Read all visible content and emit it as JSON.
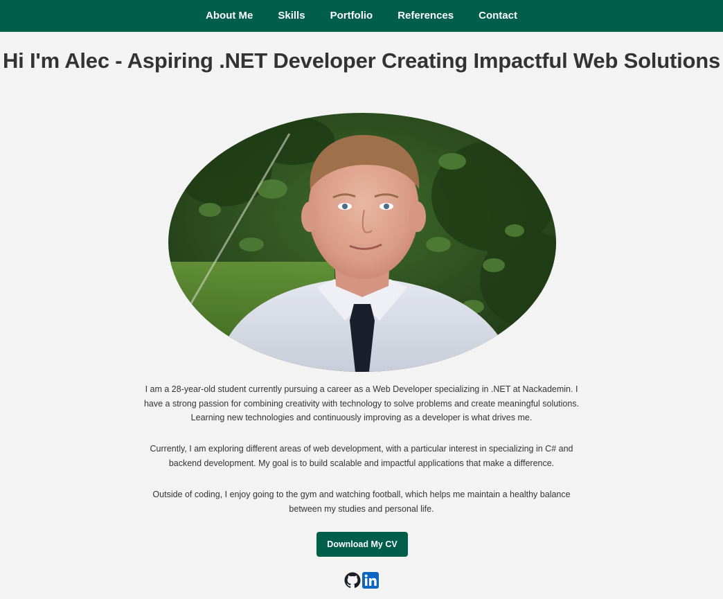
{
  "nav": {
    "items": [
      {
        "label": "About Me"
      },
      {
        "label": "Skills"
      },
      {
        "label": "Portfolio"
      },
      {
        "label": "References"
      },
      {
        "label": "Contact"
      }
    ]
  },
  "hero": {
    "title": "Hi I'm Alec - Aspiring .NET Developer Creating Impactful Web Solutions"
  },
  "about": {
    "paragraphs": [
      "I am a 28-year-old student currently pursuing a career as a Web Developer specializing in .NET at Nackademin. I have a strong passion for combining creativity with technology to solve problems and create meaningful solutions. Learning new technologies and continuously improving as a developer is what drives me.",
      "Currently, I am exploring different areas of web development, with a particular interest in specializing in C# and backend development. My goal is to build scalable and impactful applications that make a difference.",
      "Outside of coding, I enjoy going to the gym and watching football, which helps me maintain a healthy balance between my studies and personal life."
    ],
    "cv_button_label": "Download My CV"
  },
  "social": {
    "icons": [
      "github-icon",
      "linkedin-icon"
    ]
  },
  "colors": {
    "brand": "#005e4b",
    "background": "#f3f3f3",
    "text": "#333333",
    "linkedin": "#0a66c2"
  }
}
